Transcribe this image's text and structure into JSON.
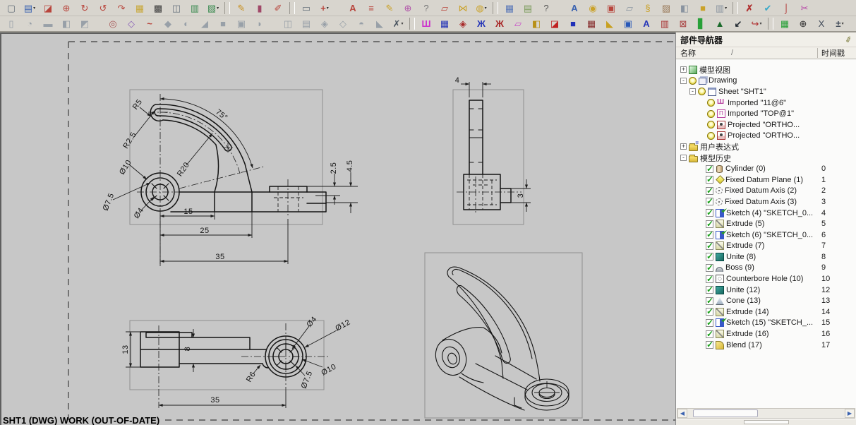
{
  "toolbar_row1": {
    "icons": [
      {
        "name": "display-part-icon",
        "g": "▢",
        "style": "color:#66707a"
      },
      {
        "name": "new-sheet-icon",
        "g": "▤",
        "style": "color:#3a62b0",
        "car": "▾"
      },
      {
        "name": "erase-sheet-icon",
        "g": "◪",
        "style": "color:#b8453c"
      },
      {
        "name": "snap-point-icon",
        "g": "⊕",
        "style": "color:#b8453c"
      },
      {
        "name": "rotate-cw-icon",
        "g": "↻",
        "style": "color:#b8453c"
      },
      {
        "name": "rotate-ccw-icon",
        "g": "↺",
        "style": "color:#b8453c"
      },
      {
        "name": "orient-view-icon",
        "g": "↷",
        "style": "color:#b8453c"
      },
      {
        "name": "view-table-icon",
        "g": "▦",
        "style": "color:#c8a83a"
      },
      {
        "name": "section-pattern-icon",
        "g": "▩",
        "style": "color:#3c3c3c"
      },
      {
        "name": "fold-views-icon",
        "g": "◫",
        "style": "color:#6a7480"
      },
      {
        "name": "update-table-icon",
        "g": "▥",
        "style": "color:#3a8a50"
      },
      {
        "name": "insert-sheet-icon",
        "g": "▧",
        "style": "color:#3a8a50",
        "car": "▾"
      },
      {
        "cls": "sep"
      },
      {
        "name": "spark-edit-icon",
        "g": "✎",
        "style": "color:#c89020"
      },
      {
        "name": "tube-icon",
        "g": "▮",
        "style": "color:#a04868"
      },
      {
        "name": "lasso-icon",
        "g": "✐",
        "style": "color:#b8453c"
      },
      {
        "cls": "sep"
      },
      {
        "name": "layout-view-icon",
        "g": "▭",
        "style": "color:#66707a"
      },
      {
        "name": "point-cross-icon",
        "g": "+",
        "style": "color:#b8453c;font-weight:bold",
        "car": "▾"
      },
      {
        "cls": "gap"
      },
      {
        "name": "text-tool-icon",
        "g": "A",
        "style": "color:#b8453c;font-weight:bold"
      },
      {
        "name": "constraint-lines-icon",
        "g": "≡",
        "style": "color:#b8453c"
      },
      {
        "name": "dim-pencil-icon",
        "g": "✎",
        "style": "color:#caa22a"
      },
      {
        "name": "datum-target-icon",
        "g": "⊕",
        "style": "color:#b050a8"
      },
      {
        "name": "inspect-icon",
        "g": "?",
        "style": "color:#777"
      },
      {
        "name": "profile-box-icon",
        "g": "▱",
        "style": "color:#b8453c"
      },
      {
        "name": "bowtie-icon",
        "g": "⋈",
        "style": "color:#caa22a"
      },
      {
        "name": "image-icon",
        "g": "◍",
        "style": "color:#caa22a",
        "car": "▾"
      },
      {
        "cls": "sep"
      },
      {
        "name": "table-blue-icon",
        "g": "▦",
        "style": "color:#5a78b8"
      },
      {
        "name": "table-green-icon",
        "g": "▤",
        "style": "color:#7a9a5a"
      },
      {
        "name": "help-icon",
        "g": "?",
        "style": "color:#555"
      },
      {
        "cls": "gap"
      },
      {
        "name": "font-style-icon",
        "g": "A",
        "style": "color:#3a62b0;font-weight:bold"
      },
      {
        "name": "bell-icon",
        "g": "◉",
        "style": "color:#caa22a"
      },
      {
        "name": "bounded-views-icon",
        "g": "▣",
        "style": "color:#b8453c"
      },
      {
        "name": "copy-view-icon",
        "g": "▱",
        "style": "color:#8a94a0"
      },
      {
        "name": "key-icon",
        "g": "§",
        "style": "color:#caa22a"
      },
      {
        "name": "hatch-region-icon",
        "g": "▨",
        "style": "color:#9a7a5a"
      },
      {
        "name": "view-cube-icon",
        "g": "◧",
        "style": "color:#8a94a0"
      },
      {
        "name": "gold-cube-icon",
        "g": "■",
        "style": "color:#caa22a"
      },
      {
        "name": "pattern-view-icon",
        "g": "▥",
        "style": "color:#8a94a0",
        "car": "▾"
      },
      {
        "cls": "sep"
      },
      {
        "name": "suppress-3d-icon",
        "g": "✗",
        "style": "color:#b03030;font-weight:bold"
      },
      {
        "name": "verify-icon",
        "g": "✔",
        "style": "color:#38a8c8"
      },
      {
        "name": "anchor-icon",
        "g": "⌡",
        "style": "color:#b03030;font-weight:bold"
      },
      {
        "name": "trim-icon",
        "g": "✂",
        "style": "color:#b84aa8"
      }
    ]
  },
  "toolbar_row2": {
    "icons": [
      {
        "name": "window-gray-icon",
        "g": "▯",
        "style": "color:#98a0a8"
      },
      {
        "name": "sphere-gray-icon",
        "g": "◔",
        "style": "color:#98a0a8"
      },
      {
        "name": "slab-gray-icon",
        "g": "▬",
        "style": "color:#98a0a8"
      },
      {
        "name": "blocks-gray-icon",
        "g": "◧",
        "style": "color:#98a0a8"
      },
      {
        "name": "claw-gray-icon",
        "g": "◩",
        "style": "color:#98a0a8"
      },
      {
        "cls": "gap"
      },
      {
        "name": "ring-icon",
        "g": "◎",
        "style": "color:#a85858"
      },
      {
        "name": "sketch-pad-icon",
        "g": "◇",
        "style": "color:#8a62b8"
      },
      {
        "name": "spline-icon",
        "g": "~",
        "style": "color:#b8453c;font-weight:bold"
      },
      {
        "name": "extrude-gray-icon",
        "g": "◆",
        "style": "color:#98a0a8"
      },
      {
        "name": "revolve-gray-icon",
        "g": "◐",
        "style": "color:#98a0a8"
      },
      {
        "name": "sweep-gray-icon",
        "g": "◢",
        "style": "color:#98a0a8"
      },
      {
        "name": "block-gray-icon",
        "g": "■",
        "style": "color:#98a0a8"
      },
      {
        "name": "pocket-gray-icon",
        "g": "▣",
        "style": "color:#98a0a8"
      },
      {
        "name": "boss-gray-icon",
        "g": "◗",
        "style": "color:#98a0a8"
      },
      {
        "cls": "gap"
      },
      {
        "name": "book-gray-icon",
        "g": "◫",
        "style": "color:#98a0a8"
      },
      {
        "name": "pad-gray-icon",
        "g": "▤",
        "style": "color:#98a0a8"
      },
      {
        "name": "emboss-gray-icon",
        "g": "◈",
        "style": "color:#98a0a8"
      },
      {
        "name": "shell-gray-icon",
        "g": "◇",
        "style": "color:#98a0a8"
      },
      {
        "name": "dome-gray-icon",
        "g": "◓",
        "style": "color:#98a0a8"
      },
      {
        "name": "wedge-gray-icon",
        "g": "◣",
        "style": "color:#98a0a8"
      },
      {
        "name": "filter-x-icon",
        "g": "✗",
        "style": "color:#4a5560",
        "car": "▾"
      },
      {
        "cls": "sep"
      },
      {
        "name": "frame-magenta-icon",
        "g": "Ш",
        "style": "color:#cc30cc;font-weight:bold"
      },
      {
        "name": "grid-blue-icon",
        "g": "▦",
        "style": "color:#2838b8"
      },
      {
        "name": "diamond-red-icon",
        "g": "◈",
        "style": "color:#a82828"
      },
      {
        "name": "chain-blue-icon",
        "g": "Ж",
        "style": "color:#2838b8;font-weight:bold"
      },
      {
        "name": "braid-red-icon",
        "g": "Ж",
        "style": "color:#a82828;font-weight:bold"
      },
      {
        "name": "sheet-magenta-icon",
        "g": "▱",
        "style": "color:#c84ac8"
      },
      {
        "name": "book-gold-icon",
        "g": "◧",
        "style": "color:#b89018"
      },
      {
        "name": "dice-red-icon",
        "g": "◪",
        "style": "color:#c02020"
      },
      {
        "name": "cube-blue-icon",
        "g": "■",
        "style": "color:#2030b8"
      },
      {
        "name": "table-dark-icon",
        "g": "▦",
        "style": "color:#883030"
      },
      {
        "name": "ramp-gold-icon",
        "g": "◣",
        "style": "color:#c8a020"
      },
      {
        "name": "monitor-blue-icon",
        "g": "▣",
        "style": "color:#2858b8"
      },
      {
        "name": "font-blue-icon",
        "g": "A",
        "style": "color:#2838b8;font-weight:bold"
      },
      {
        "name": "plot-red-icon",
        "g": "▥",
        "style": "color:#a83030"
      },
      {
        "name": "envelope-x-icon",
        "g": "⊠",
        "style": "color:#a84040"
      },
      {
        "name": "flag-green-icon",
        "g": "▋",
        "style": "color:#28a038"
      },
      {
        "name": "stud-green-icon",
        "g": "▲",
        "style": "color:#1a6a2a"
      },
      {
        "name": "branch-arrow-icon",
        "g": "↙",
        "style": "color:#202830;font-weight:bold"
      },
      {
        "name": "arc-arrow-icon",
        "g": "↪",
        "style": "color:#b03030",
        "car": "▾"
      },
      {
        "cls": "sep"
      },
      {
        "name": "hatch-table-icon",
        "g": "▦",
        "style": "color:#28a038"
      },
      {
        "name": "target-circle-icon",
        "g": "⊕",
        "style": "color:#303030"
      },
      {
        "name": "xyz-note-icon",
        "g": "X",
        "style": "color:#404a58"
      },
      {
        "name": "tolerance-icon",
        "g": "±",
        "style": "color:#404a58;font-weight:bold",
        "car": "▾"
      }
    ]
  },
  "drawing": {
    "status_label": "SHT1 (DWG) WORK (OUT-OF-DATE)",
    "dim_labels": [
      {
        "text": "R5",
        "style": "left:193px;top:100px;transform:translate(-50%,-50%) rotate(-55deg)"
      },
      {
        "text": "R2.5",
        "style": "left:182px;top:151px;transform:translate(-50%,-50%) rotate(-58deg)"
      },
      {
        "text": "Ø10",
        "style": "left:176px;top:189px;transform:translate(-50%,-50%) rotate(-58deg)"
      },
      {
        "text": "Ø7.5",
        "style": "left:152px;top:238px;transform:translate(-50%,-50%) rotate(-68deg)"
      },
      {
        "text": "Ø4",
        "style": "left:195px;top:254px;transform:translate(-50%,-50%) rotate(-55deg)"
      },
      {
        "text": "R20",
        "style": "left:258px;top:192px;transform:translate(-50%,-50%) rotate(-55deg)"
      },
      {
        "text": "75°",
        "style": "left:312px;top:115px;transform:translate(-50%,-50%) rotate(38deg)"
      },
      {
        "text": "2.5",
        "style": "left:471px;top:190px;transform:translate(-50%,-50%) rotate(-90deg)"
      },
      {
        "text": "4.5",
        "style": "left:494px;top:187px;transform:translate(-50%,-50%) rotate(-90deg)"
      },
      {
        "text": "15",
        "style": "left:265px;top:252px;transform:translate(-50%,-50%)"
      },
      {
        "text": "25",
        "style": "left:288px;top:279px;transform:translate(-50%,-50%)"
      },
      {
        "text": "35",
        "style": "left:310px;top:316px;transform:translate(-50%,-50%)"
      },
      {
        "text": "4",
        "style": "left:646px;top:66px;transform:translate(-50%,-50%)"
      },
      {
        "text": "3",
        "style": "left:736px;top:229px;transform:translate(-50%,-50%) rotate(-90deg)"
      },
      {
        "text": "13",
        "style": "left:176px;top:447px;transform:translate(-50%,-50%) rotate(-90deg)"
      },
      {
        "text": "8",
        "style": "left:264px;top:446px;transform:translate(-50%,-50%) rotate(-90deg)"
      },
      {
        "text": "35",
        "style": "left:303px;top:519px;transform:translate(-50%,-50%)"
      },
      {
        "text": "Ø4",
        "style": "left:440px;top:408px;transform:translate(-50%,-50%) rotate(-50deg)"
      },
      {
        "text": "Ø12",
        "style": "left:484px;top:413px;transform:translate(-50%,-50%) rotate(-28deg)"
      },
      {
        "text": "Ø10",
        "style": "left:464px;top:476px;transform:translate(-50%,-50%) rotate(-28deg)"
      },
      {
        "text": "Ø7.5",
        "style": "left:433px;top:490px;transform:translate(-50%,-50%) rotate(-68deg)"
      },
      {
        "text": "R6",
        "style": "left:354px;top:486px;transform:translate(-50%,-50%) rotate(-58deg)"
      }
    ]
  },
  "navigator": {
    "title": "部件导航器",
    "pin_icon": "pin-icon",
    "columns": {
      "name": "名称",
      "sort": "/",
      "timestamp": "时间戳"
    },
    "tree": [
      {
        "exp": "+",
        "icon": "model-views-icon",
        "label": "模型视图",
        "style": "padding-left:6px"
      },
      {
        "exp": "-",
        "icon": "clock-icon",
        "icon2": "drawing-icon",
        "label": "Drawing",
        "style": "padding-left:6px"
      },
      {
        "exp": "-",
        "icon": "clock-icon",
        "icon2": "sheet-icon",
        "label": "Sheet \"SHT1\"",
        "style": "padding-left:19px"
      },
      {
        "icon": "clock-icon",
        "icon2": "imported-view-icon",
        "label": "Imported \"11@6\"",
        "style": "padding-left:32px"
      },
      {
        "icon": "clock-icon",
        "icon2": "imported-view2-icon",
        "label": "Imported \"TOP@1\"",
        "style": "padding-left:32px"
      },
      {
        "icon": "clock-icon",
        "icon2": "projected-view-icon",
        "label": "Projected \"ORTHO...",
        "style": "padding-left:32px"
      },
      {
        "icon": "clock-icon",
        "icon2": "projected-view-icon",
        "label": "Projected \"ORTHO...",
        "style": "padding-left:32px"
      },
      {
        "exp": "+",
        "icon": "expressions-folder-icon",
        "label": "用户表达式",
        "style": "padding-left:6px"
      },
      {
        "exp": "-",
        "icon": "history-folder-icon",
        "label": "模型历史",
        "style": "padding-left:6px"
      },
      {
        "chk": "on",
        "icon": "cylinder-icon",
        "label": "Cylinder (0)",
        "ts": "0",
        "style": "padding-left:30px"
      },
      {
        "chk": "on",
        "icon": "datum-plane-icon",
        "label": "Fixed Datum Plane (1)",
        "ts": "1",
        "style": "padding-left:30px"
      },
      {
        "chk": "on",
        "icon": "datum-axis-icon",
        "label": "Fixed Datum Axis (2)",
        "ts": "2",
        "style": "padding-left:30px"
      },
      {
        "chk": "on",
        "icon": "datum-axis-icon",
        "label": "Fixed Datum Axis (3)",
        "ts": "3",
        "style": "padding-left:30px"
      },
      {
        "chk": "on",
        "icon": "sketch-icon",
        "label": "Sketch (4) \"SKETCH_0...",
        "ts": "4",
        "style": "padding-left:30px"
      },
      {
        "chk": "on",
        "icon": "extrude-icon",
        "label": "Extrude (5)",
        "ts": "5",
        "style": "padding-left:30px"
      },
      {
        "chk": "on",
        "icon": "sketch-icon",
        "label": "Sketch (6) \"SKETCH_0...",
        "ts": "6",
        "style": "padding-left:30px"
      },
      {
        "chk": "on",
        "icon": "extrude-icon",
        "label": "Extrude (7)",
        "ts": "7",
        "style": "padding-left:30px"
      },
      {
        "chk": "on",
        "icon": "unite-icon",
        "label": "Unite (8)",
        "ts": "8",
        "style": "padding-left:30px"
      },
      {
        "chk": "on",
        "icon": "boss-icon",
        "label": "Boss (9)",
        "ts": "9",
        "style": "padding-left:30px"
      },
      {
        "chk": "on",
        "icon": "counterbore-icon",
        "label": "Counterbore Hole (10)",
        "ts": "10",
        "style": "padding-left:30px"
      },
      {
        "chk": "on",
        "icon": "unite-icon",
        "label": "Unite (12)",
        "ts": "12",
        "style": "padding-left:30px"
      },
      {
        "chk": "on",
        "icon": "cone-icon",
        "label": "Cone (13)",
        "ts": "13",
        "style": "padding-left:30px"
      },
      {
        "chk": "on",
        "icon": "extrude-icon",
        "label": "Extrude (14)",
        "ts": "14",
        "style": "padding-left:30px"
      },
      {
        "chk": "on",
        "icon": "sketch-icon",
        "label": "Sketch (15) \"SKETCH_...",
        "ts": "15",
        "style": "padding-left:30px"
      },
      {
        "chk": "on",
        "icon": "extrude-icon",
        "label": "Extrude (16)",
        "ts": "16",
        "style": "padding-left:30px"
      },
      {
        "chk": "on",
        "icon": "blend-icon",
        "label": "Blend (17)",
        "ts": "17",
        "style": "padding-left:30px"
      }
    ]
  }
}
